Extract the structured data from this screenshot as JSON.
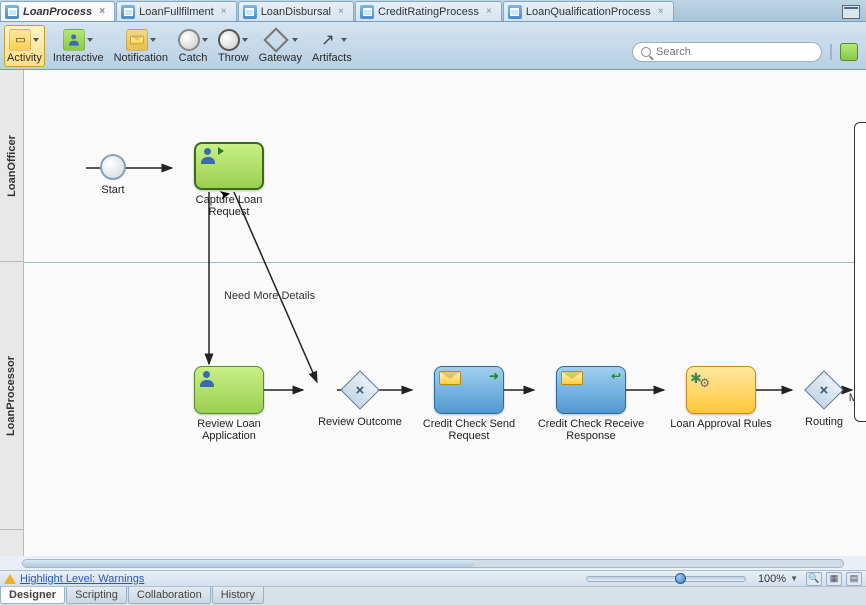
{
  "tabs": [
    {
      "label": "LoanProcess",
      "active": true
    },
    {
      "label": "LoanFullfilment",
      "active": false
    },
    {
      "label": "LoanDisbursal",
      "active": false
    },
    {
      "label": "CreditRatingProcess",
      "active": false
    },
    {
      "label": "LoanQualificationProcess",
      "active": false
    }
  ],
  "toolbar": [
    {
      "name": "activity",
      "label": "Activity",
      "active": true
    },
    {
      "name": "interactive",
      "label": "Interactive"
    },
    {
      "name": "notification",
      "label": "Notification"
    },
    {
      "name": "catch",
      "label": "Catch"
    },
    {
      "name": "throw",
      "label": "Throw"
    },
    {
      "name": "gateway",
      "label": "Gateway"
    },
    {
      "name": "artifacts",
      "label": "Artifacts"
    }
  ],
  "search_placeholder": "Search",
  "lanes": {
    "officer": "LoanOfficer",
    "processor": "LoanProcessor"
  },
  "nodes": {
    "start": {
      "label": "Start"
    },
    "capture": {
      "label": "Capture Loan Request"
    },
    "review_app": {
      "label": "Review Loan Application"
    },
    "review_outcome": {
      "label": "Review Outcome"
    },
    "credit_send": {
      "label": "Credit Check Send Request"
    },
    "credit_recv": {
      "label": "Credit Check Receive Response"
    },
    "approval": {
      "label": "Loan Approval Rules"
    },
    "routing": {
      "label": "Routing"
    },
    "ma_partial": {
      "label": "Ma"
    }
  },
  "edges": {
    "need_more": "Need More Details"
  },
  "status": {
    "highlight": "Highlight Level: Warnings",
    "zoom": "100%"
  },
  "bottom_tabs": [
    "Designer",
    "Scripting",
    "Collaboration",
    "History"
  ]
}
